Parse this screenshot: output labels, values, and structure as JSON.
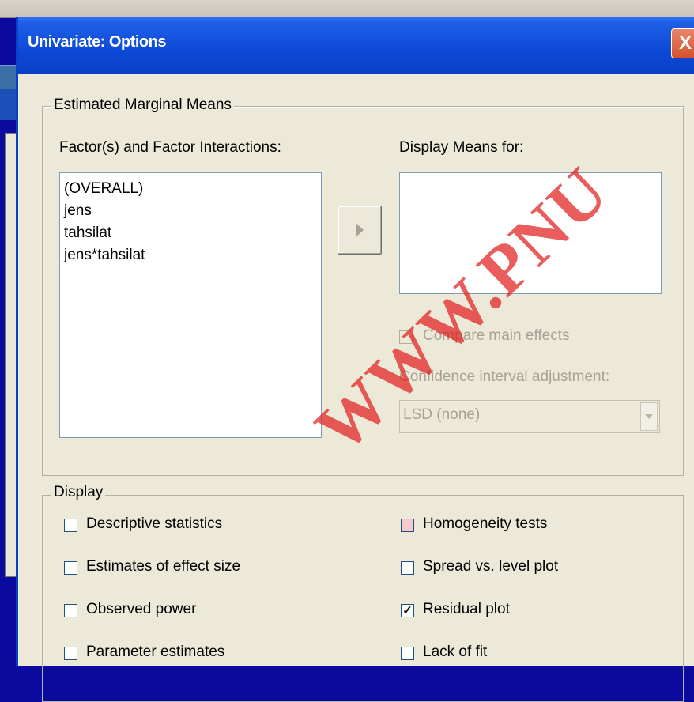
{
  "window": {
    "title": "Univariate: Options",
    "close_label": "X"
  },
  "emm": {
    "legend": "Estimated Marginal Means",
    "factors_label": "Factor(s) and Factor Interactions:",
    "factors": [
      "(OVERALL)",
      "jens",
      "tahsilat",
      "jens*tahsilat"
    ],
    "move_button_icon": "right-arrow-icon",
    "display_means_label": "Display Means for:",
    "display_means_items": [],
    "compare_main_effects": {
      "label": "Compare main effects",
      "checked": false,
      "enabled": false
    },
    "ci_adjustment_label": "Confidence interval adjustment:",
    "ci_adjustment_value": "LSD (none)"
  },
  "display": {
    "legend": "Display",
    "left_options": [
      {
        "label": "Descriptive statistics",
        "checked": false
      },
      {
        "label": "Estimates of effect size",
        "checked": false
      },
      {
        "label": "Observed power",
        "checked": false
      },
      {
        "label": "Parameter estimates",
        "checked": false
      }
    ],
    "right_options": [
      {
        "label": "Homogeneity tests",
        "checked": false
      },
      {
        "label": "Spread vs. level plot",
        "checked": false
      },
      {
        "label": "Residual plot",
        "checked": true
      },
      {
        "label": "Lack of fit",
        "checked": false
      }
    ]
  },
  "watermark": "WWW.PNU",
  "colors": {
    "title_bar": "#0a3fc4",
    "dialog_bg": "#ece9d8",
    "close_button": "#d5512c",
    "watermark": "#e01e1e"
  }
}
